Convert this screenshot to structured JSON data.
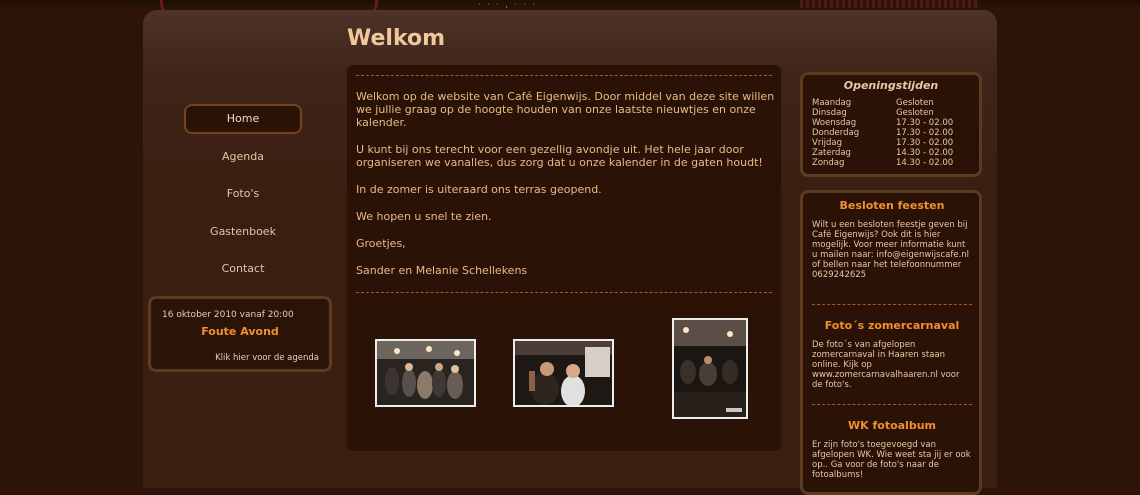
{
  "header": {
    "page_title": "Welkom"
  },
  "nav": {
    "items": [
      {
        "label": "Home",
        "active": true
      },
      {
        "label": "Agenda",
        "active": false
      },
      {
        "label": "Foto's",
        "active": false
      },
      {
        "label": "Gastenboek",
        "active": false
      },
      {
        "label": "Contact",
        "active": false
      }
    ]
  },
  "event": {
    "date": "16 oktober 2010 vanaf 20:00",
    "title": "Foute Avond",
    "link": "Klik hier voor de agenda"
  },
  "main": {
    "paragraphs": [
      "Welkom op de website van Café Eigenwijs. Door middel van deze site willen we jullie graag op de hoogte houden van onze laatste nieuwtjes en onze kalender.",
      "U kunt bij ons terecht voor een gezellig avondje uit. Het hele jaar door organiseren we vanalles, dus zorg dat u onze kalender in de gaten houdt!",
      "In de zomer is uiteraard ons terras geopend.",
      "We hopen u snel te zien.",
      "Groetjes,",
      "Sander en Melanie Schellekens"
    ]
  },
  "hours": {
    "title": "Openingstijden",
    "rows": [
      {
        "day": "Maandag",
        "time": "Gesloten"
      },
      {
        "day": "Dinsdag",
        "time": "Gesloten"
      },
      {
        "day": "Woensdag",
        "time": "17.30 - 02.00"
      },
      {
        "day": "Donderdag",
        "time": "17.30 - 02.00"
      },
      {
        "day": "Vrijdag",
        "time": "17.30 - 02.00"
      },
      {
        "day": "Zaterdag",
        "time": "14.30 - 02.00"
      },
      {
        "day": "Zondag",
        "time": "14.30 - 02.00"
      }
    ]
  },
  "sidebar": {
    "sections": [
      {
        "title": "Besloten feesten",
        "text": "Wilt u een besloten feestje geven bij Café Eigenwijs? Ook dit is hier mogelijk. Voor meer informatie kunt u mailen naar: info@eigenwijscafe.nl of bellen naar het telefoonnummer 0629242625"
      },
      {
        "title": "Foto´s zomercarnaval",
        "text": "De foto´s van afgelopen zomercarnaval in Haaren staan online. Kijk op www.zomercarnavalhaaren.nl voor de foto's."
      },
      {
        "title": "WK fotoalbum",
        "text": "Er zijn foto's toegevoegd van afgelopen WK. Wie weet sta jij er ook op.. Ga voor de foto's naar de fotoalbums!"
      }
    ]
  },
  "colors": {
    "background": "#2c1508",
    "panel": "#3a1e10",
    "title": "#f1c89c",
    "accent": "#f09030",
    "text": "#e8b888"
  }
}
